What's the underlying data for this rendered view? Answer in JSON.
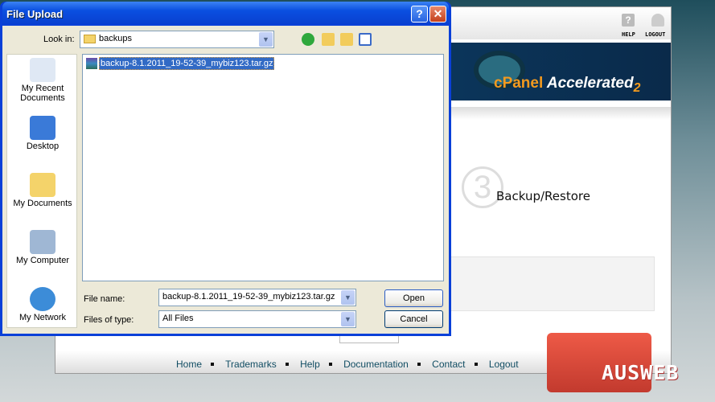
{
  "page": {
    "help_label": "HELP",
    "logout_label": "LOGOUT",
    "banner_brand": "cPanel",
    "banner_text": "Accelerated",
    "banner_version": "2",
    "step_number": "3",
    "section_title": "Backup/Restore",
    "footer_links": [
      "Home",
      "Trademarks",
      "Help",
      "Documentation",
      "Contact",
      "Logout"
    ]
  },
  "watermark": "AUSWEB",
  "dialog": {
    "title": "File Upload",
    "help_btn": "?",
    "close_btn": "✕",
    "look_in_label": "Look in:",
    "look_in_value": "backups",
    "places": [
      "My Recent Documents",
      "Desktop",
      "My Documents",
      "My Computer",
      "My Network"
    ],
    "files": [
      {
        "name": "backup-8.1.2011_19-52-39_mybiz123.tar.gz",
        "selected": true
      }
    ],
    "file_name_label": "File name:",
    "file_name_value": "backup-8.1.2011_19-52-39_mybiz123.tar.gz",
    "file_type_label": "Files of type:",
    "file_type_value": "All Files",
    "open_label": "Open",
    "cancel_label": "Cancel"
  },
  "colors": {
    "titlebar": "#0a4fe0",
    "selection": "#316ac5",
    "cpanel_orange": "#f49a1e",
    "ausweb_red": "#e04a3c"
  }
}
